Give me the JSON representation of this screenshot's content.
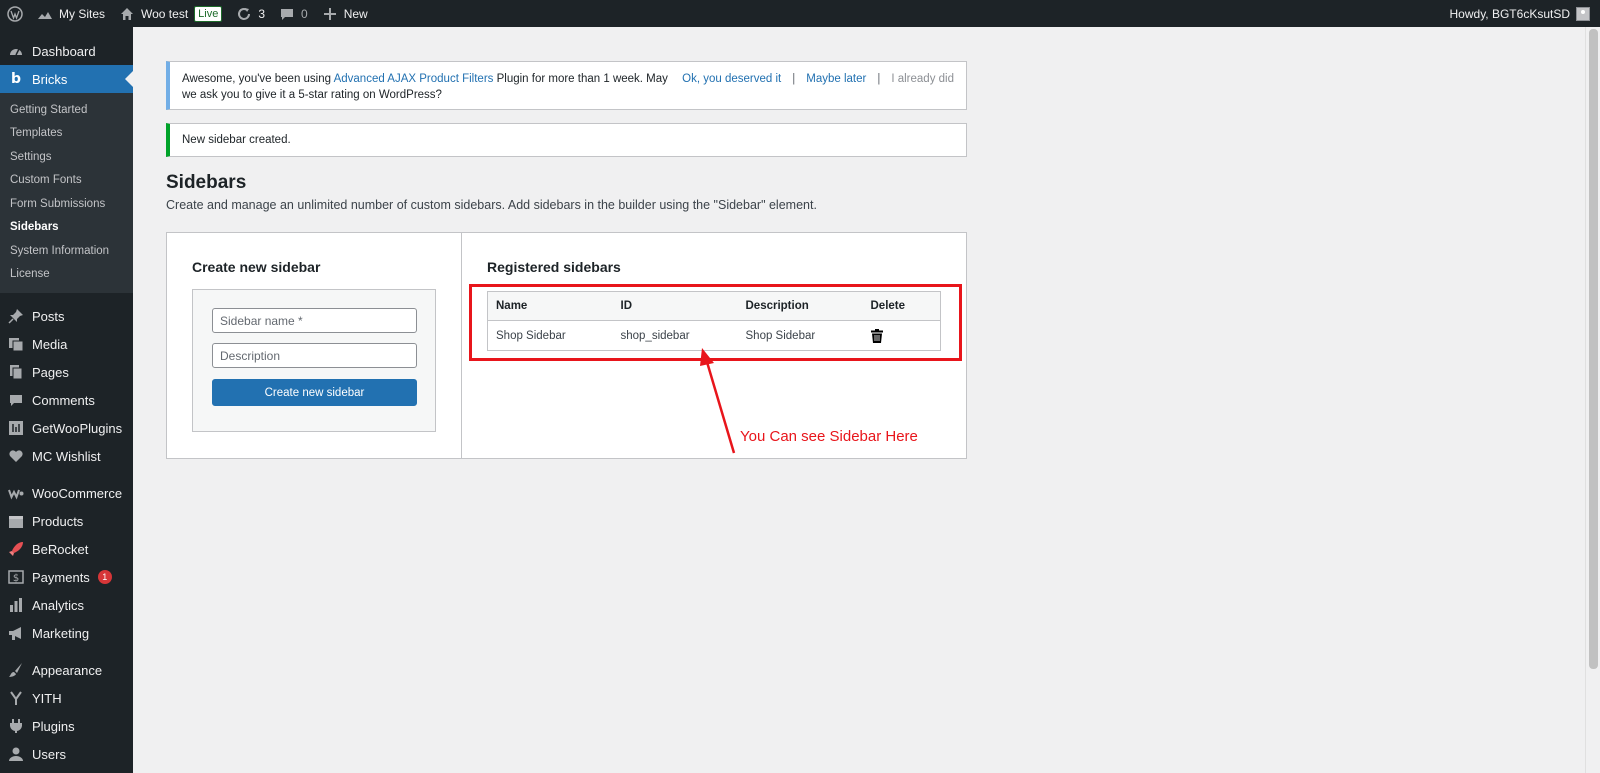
{
  "adminbar": {
    "my_sites": "My Sites",
    "site_name": "Woo test",
    "live_badge": "Live",
    "updates_count": "3",
    "comments_count": "0",
    "new_label": "New",
    "howdy": "Howdy, BGT6cKsutSD"
  },
  "menu": {
    "dashboard": "Dashboard",
    "bricks": "Bricks",
    "submenu": {
      "getting_started": "Getting Started",
      "templates": "Templates",
      "settings": "Settings",
      "custom_fonts": "Custom Fonts",
      "form_submissions": "Form Submissions",
      "sidebars": "Sidebars",
      "system_information": "System Information",
      "license": "License"
    },
    "posts": "Posts",
    "media": "Media",
    "pages": "Pages",
    "comments": "Comments",
    "getwooplugins": "GetWooPlugins",
    "mc_wishlist": "MC Wishlist",
    "woocommerce": "WooCommerce",
    "products": "Products",
    "berocket": "BeRocket",
    "payments": "Payments",
    "payments_badge": "1",
    "analytics": "Analytics",
    "marketing": "Marketing",
    "appearance": "Appearance",
    "yith": "YITH",
    "plugins": "Plugins",
    "users": "Users"
  },
  "notices": {
    "rating_prefix": "Awesome, you've been using ",
    "rating_link": "Advanced AJAX Product Filters",
    "rating_suffix": " Plugin for more than 1 week. May we ask you to give it a 5-star rating on WordPress?",
    "ok_link": "Ok, you deserved it",
    "maybe_later": "Maybe later",
    "already_did": "I already did",
    "separator": "|",
    "success": "New sidebar created."
  },
  "page": {
    "title": "Sidebars",
    "description": "Create and manage an unlimited number of custom sidebars. Add sidebars in the builder using the \"Sidebar\" element."
  },
  "create_panel": {
    "heading": "Create new sidebar",
    "name_placeholder": "Sidebar name *",
    "description_placeholder": "Description",
    "button": "Create new sidebar"
  },
  "registered_panel": {
    "heading": "Registered sidebars",
    "columns": {
      "name": "Name",
      "id": "ID",
      "description": "Description",
      "delete": "Delete"
    },
    "rows": [
      {
        "name": "Shop Sidebar",
        "id": "shop_sidebar",
        "description": "Shop Sidebar"
      }
    ]
  },
  "annotation": {
    "text": "You Can see Sidebar Here",
    "color": "#e8151b"
  },
  "colors": {
    "accent": "#2271b1",
    "admin_dark": "#1d2327",
    "success": "#00a32a",
    "info": "#72aee6"
  }
}
